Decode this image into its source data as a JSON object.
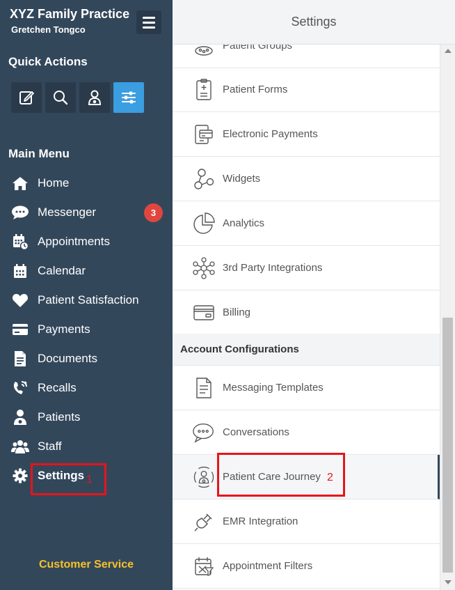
{
  "sidebar": {
    "practice_name": "XYZ Family Practice",
    "user_name": "Gretchen Tongco",
    "quick_actions_title": "Quick Actions",
    "quick_actions": [
      {
        "icon": "compose-icon"
      },
      {
        "icon": "search-icon"
      },
      {
        "icon": "patient-icon"
      },
      {
        "icon": "sliders-icon",
        "active": true
      }
    ],
    "main_menu_title": "Main Menu",
    "menu": [
      {
        "label": "Home",
        "icon": "home-icon"
      },
      {
        "label": "Messenger",
        "icon": "chat-icon",
        "badge": "3"
      },
      {
        "label": "Appointments",
        "icon": "appointments-icon"
      },
      {
        "label": "Calendar",
        "icon": "calendar-icon"
      },
      {
        "label": "Patient Satisfaction",
        "icon": "heart-icon"
      },
      {
        "label": "Payments",
        "icon": "credit-card-icon"
      },
      {
        "label": "Documents",
        "icon": "document-icon"
      },
      {
        "label": "Recalls",
        "icon": "recalls-icon"
      },
      {
        "label": "Patients",
        "icon": "patient-icon"
      },
      {
        "label": "Staff",
        "icon": "staff-icon"
      },
      {
        "label": "Settings",
        "icon": "gear-icon"
      }
    ],
    "customer_service": "Customer Service"
  },
  "settings": {
    "title": "Settings",
    "items_top": [
      {
        "label": "Patient Groups",
        "icon": "patient-groups-icon"
      },
      {
        "label": "Patient Forms",
        "icon": "clipboard-icon"
      },
      {
        "label": "Electronic Payments",
        "icon": "electronic-payments-icon"
      },
      {
        "label": "Widgets",
        "icon": "widgets-icon"
      },
      {
        "label": "Analytics",
        "icon": "pie-chart-icon"
      },
      {
        "label": "3rd Party Integrations",
        "icon": "network-icon"
      },
      {
        "label": "Billing",
        "icon": "billing-card-icon"
      }
    ],
    "account_configurations_title": "Account Configurations",
    "items_account": [
      {
        "label": "Messaging Templates",
        "icon": "template-icon"
      },
      {
        "label": "Conversations",
        "icon": "conversations-icon"
      },
      {
        "label": "Patient Care Journey",
        "icon": "care-journey-icon",
        "active": true
      },
      {
        "label": "EMR Integration",
        "icon": "plug-icon"
      },
      {
        "label": "Appointment Filters",
        "icon": "calendar-filter-icon"
      }
    ]
  },
  "annotations": {
    "step1": "1",
    "step2": "2"
  },
  "colors": {
    "sidebar_bg": "#33475b",
    "accent": "#3a9ee0",
    "badge": "#e0463e",
    "highlight": "#e8141a",
    "customer_service": "#f6c22b"
  }
}
